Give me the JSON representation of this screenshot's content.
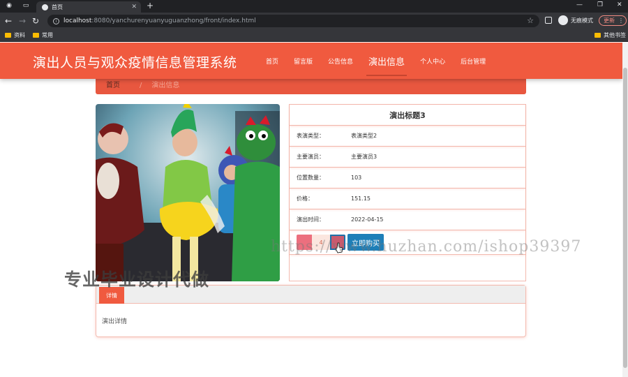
{
  "browser": {
    "tab_title": "首页",
    "url_host": "localhost",
    "url_path": ":8080/yanchurenyuanyuguanzhong/front/index.html",
    "incognito_label": "无痕模式",
    "update_label": "更新",
    "bookmarks": [
      "资料",
      "常用"
    ],
    "other_bookmarks": "其他书签"
  },
  "site": {
    "title": "演出人员与观众疫情信息管理系统",
    "nav": [
      "首页",
      "留言版",
      "公告信息",
      "演出信息",
      "个人中心",
      "后台管理"
    ],
    "active_nav_index": 3
  },
  "breadcrumb": {
    "home": "首页",
    "separator": "/",
    "current": "演出信息"
  },
  "detail": {
    "title": "演出标题3",
    "rows": [
      {
        "label": "表演类型：",
        "value": "表演类型2"
      },
      {
        "label": "主要演员：",
        "value": "主要演员3"
      },
      {
        "label": "位置数量：",
        "value": "103"
      },
      {
        "label": "价格：",
        "value": "151.15"
      },
      {
        "label": "演出时间：",
        "value": "2022-04-15"
      }
    ],
    "quantity": "4",
    "buy_label": "立即购买",
    "tab_label": "详情",
    "content": "演出详情"
  },
  "watermarks": {
    "cn": "专业毕业设计代做",
    "url": "https://www.huzhan.com/ishop39397"
  },
  "colors": {
    "header": "#f05a3f",
    "buy_button": "#1e7fb8",
    "minus_button": "#ec6f7e"
  }
}
